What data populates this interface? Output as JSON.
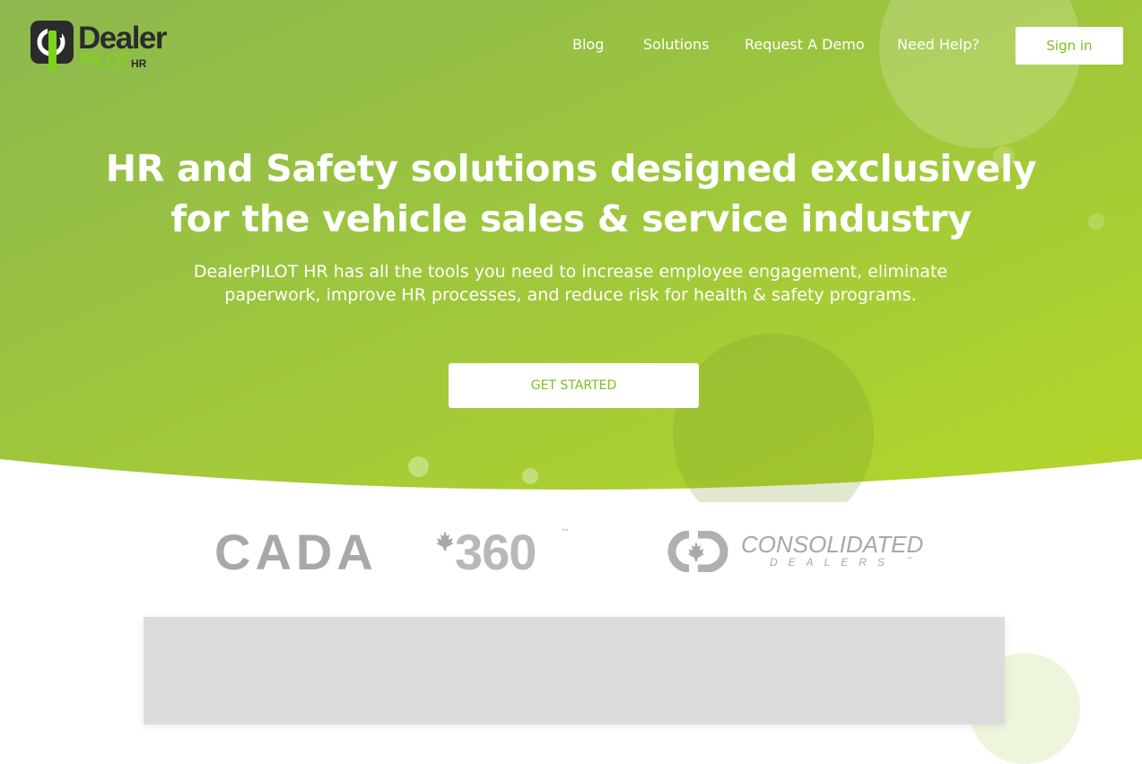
{
  "brand": {
    "logo_word_1": "Dealer",
    "logo_word_2": "PILOT",
    "logo_word_3": "HR"
  },
  "nav": {
    "items": [
      {
        "label": "Blog"
      },
      {
        "label": "Solutions"
      },
      {
        "label": "Request A Demo"
      },
      {
        "label": "Need Help?"
      }
    ],
    "signin_label": "Sign in"
  },
  "hero": {
    "headline_line_1": "HR and Safety solutions designed exclusively",
    "headline_line_2": "for the vehicle sales & service industry",
    "subtext_line_1": "DealerPILOT HR has all the tools you need to increase employee engagement, eliminate",
    "subtext_line_2": "paperwork, improve HR processes, and reduce risk for health & safety programs.",
    "cta_label": "GET STARTED"
  },
  "partners": {
    "cada_word": "CADA",
    "cada_number": "360",
    "cada_tm": "™",
    "consolidated_word": "CONSOLIDATED",
    "dealers_word": "DEALERS",
    "dealers_tm": "™"
  },
  "colors": {
    "gradient_start": "#8cb84e",
    "gradient_end": "#b3d62a",
    "accent_green": "#7cbf1e",
    "logo_green": "#7fd31e",
    "partner_gray": "#a8a8a8"
  },
  "icons": {
    "logo_mark": "power-symbol-icon",
    "maple_leaf": "maple-leaf-icon"
  }
}
